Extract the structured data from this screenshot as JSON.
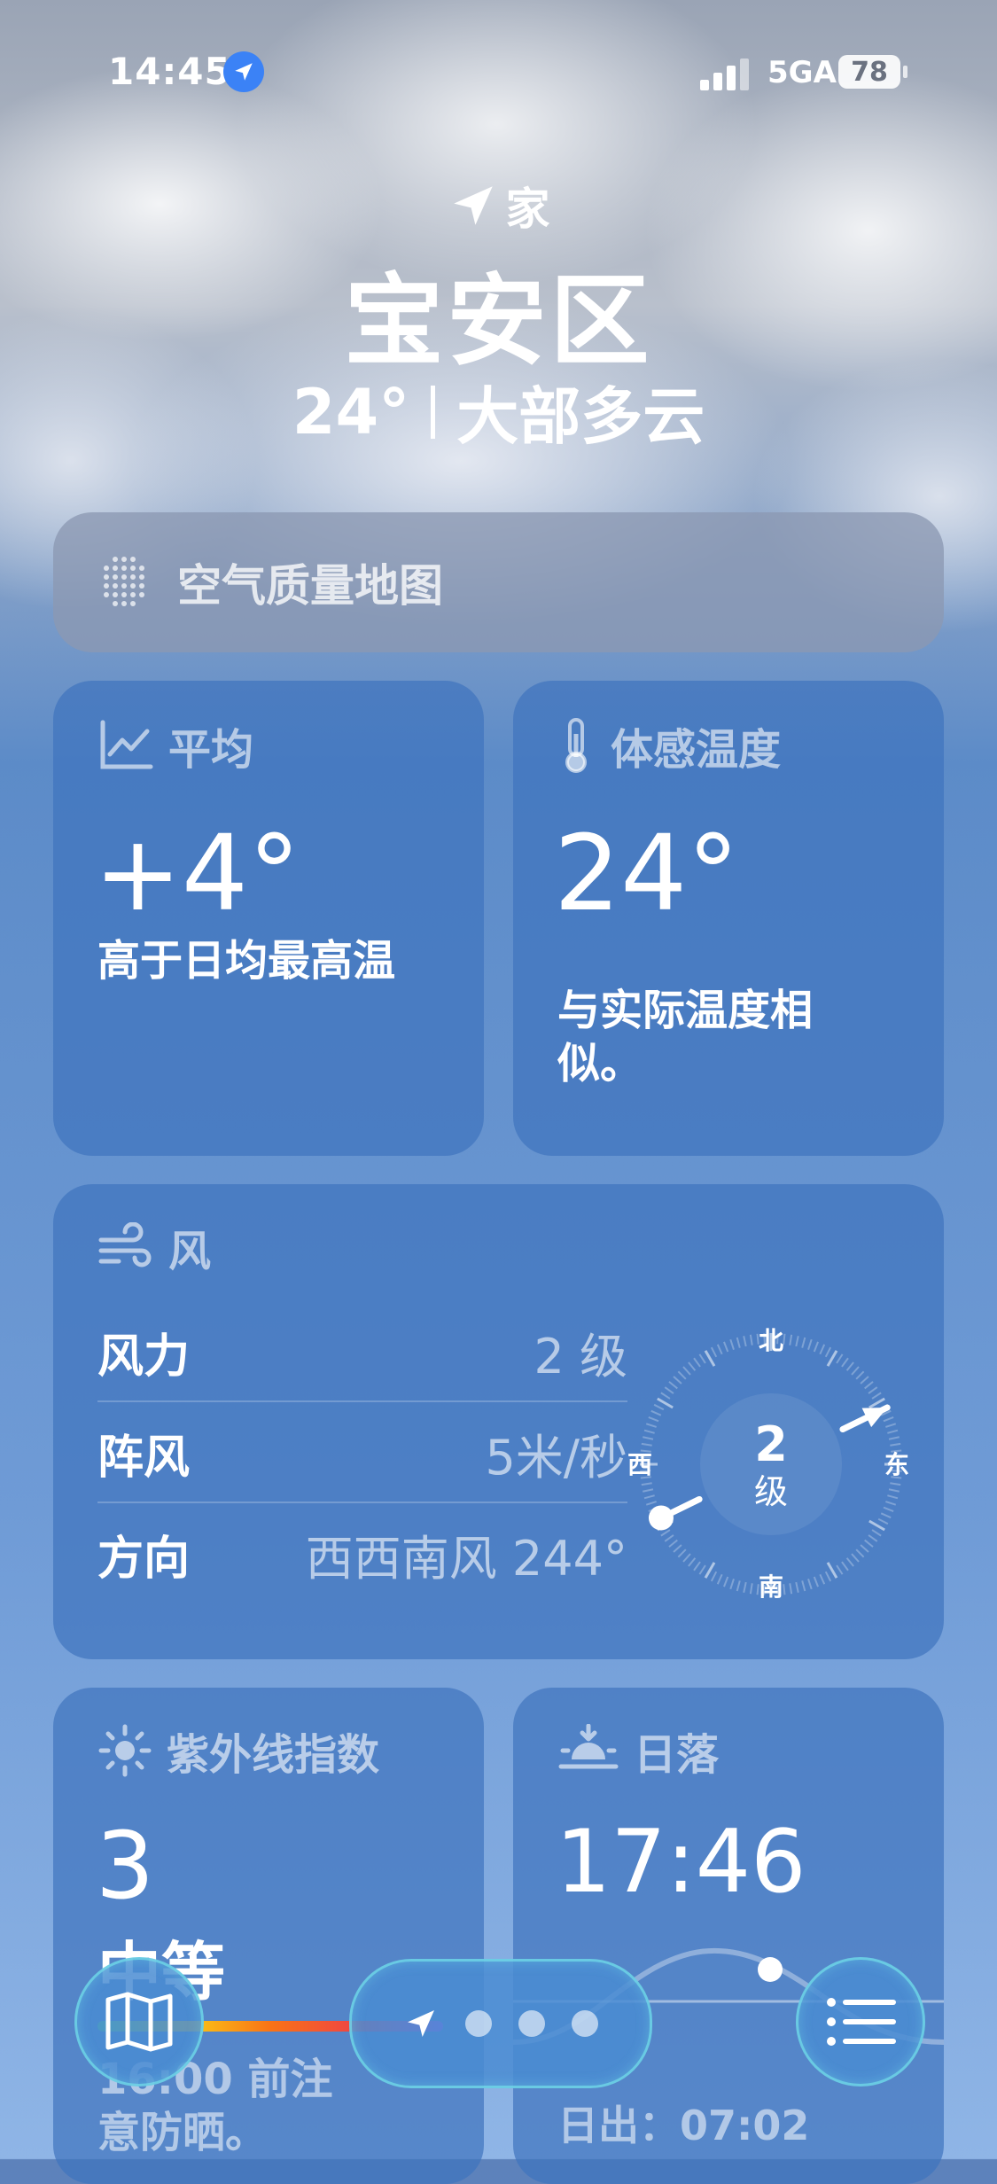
{
  "status_bar": {
    "time": "14:45",
    "network": "5GA",
    "battery": "78"
  },
  "header": {
    "location_label": "家",
    "city": "宝安区",
    "temperature": "24°",
    "condition": "大部多云"
  },
  "air_quality": {
    "label": "空气质量地图"
  },
  "average": {
    "title": "平均",
    "value": "+4°",
    "desc": "高于日均最高温"
  },
  "feels_like": {
    "title": "体感温度",
    "value": "24°",
    "desc": "与实际温度相似。"
  },
  "wind": {
    "title": "风",
    "rows": [
      {
        "label": "风力",
        "value": "2 级"
      },
      {
        "label": "阵风",
        "value": "5米/秒"
      },
      {
        "label": "方向",
        "value": "西西南风 244°"
      }
    ],
    "compass": {
      "north": "北",
      "south": "南",
      "east": "东",
      "west": "西",
      "center_value": "2",
      "center_unit": "级",
      "direction_degrees": 244
    }
  },
  "uv": {
    "title": "紫外线指数",
    "value": "3",
    "level": "中等",
    "desc": "16:00 前注意防晒。"
  },
  "sunset": {
    "title": "日落",
    "time": "17:46",
    "sunrise": "日出：07:02"
  },
  "icons": {
    "status_location": "location-arrow-icon",
    "aq": "dots-grid-icon",
    "average": "chart-line-icon",
    "feels": "thermometer-icon",
    "wind": "wind-icon",
    "uv": "sun-icon",
    "sunset": "sunset-icon",
    "map": "map-icon",
    "list": "list-icon"
  },
  "colors": {
    "card_blue": "#3f74bd",
    "status_location": "#3b82f6",
    "accent_cyan": "#78e6eb"
  }
}
